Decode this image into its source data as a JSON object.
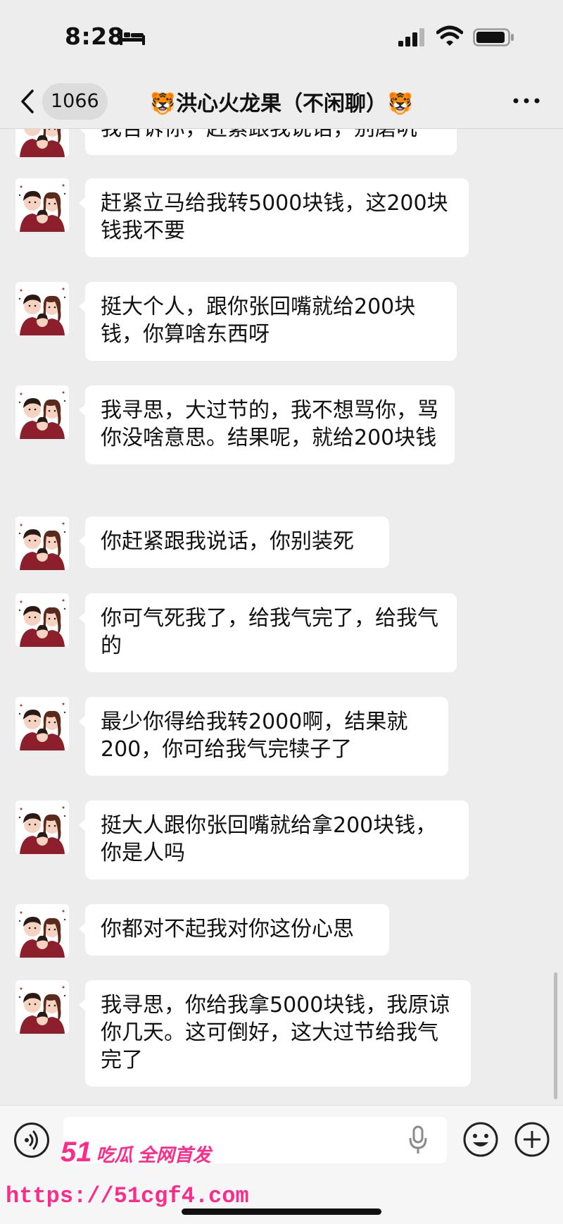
{
  "status_bar": {
    "time": "8:28"
  },
  "nav": {
    "unread_count": "1066",
    "title": "🐯洪心火龙果（不闲聊）🐯"
  },
  "messages": [
    {
      "text": "我告诉你，赶紧跟我说话，别磨叽"
    },
    {
      "text": "赶紧立马给我转5000块钱，这200块钱我不要"
    },
    {
      "text": "挺大个人，跟你张回嘴就给200块钱，你算啥东西呀"
    },
    {
      "text": "我寻思，大过节的，我不想骂你，骂你没啥意思。结果呢，就给200块钱"
    },
    {
      "text": "你赶紧跟我说话，你别装死"
    },
    {
      "text": "你可气死我了，给我气完了，给我气的"
    },
    {
      "text": "最少你得给我转2000啊，结果就200，你可给我气完犊子了"
    },
    {
      "text": "挺大人跟你张回嘴就给拿200块钱，你是人吗"
    },
    {
      "text": "你都对不起我对你这份心思"
    },
    {
      "text": "我寻思，你给我拿5000块钱，我原谅你几天。这可倒好，这大过节给我气完了"
    }
  ],
  "input": {
    "value": ""
  },
  "watermark": {
    "logo_num": "51",
    "logo_text": "吃瓜 全网首发",
    "url": "https://51cgf4.com"
  },
  "colors": {
    "background": "#ededed",
    "bubble": "#ffffff",
    "watermark": "#ff2a8a"
  },
  "icons": [
    "bed-icon",
    "signal-icon",
    "wifi-icon",
    "battery-icon",
    "back-icon",
    "more-icon",
    "voice-icon",
    "mic-icon",
    "emoji-icon",
    "plus-icon"
  ]
}
